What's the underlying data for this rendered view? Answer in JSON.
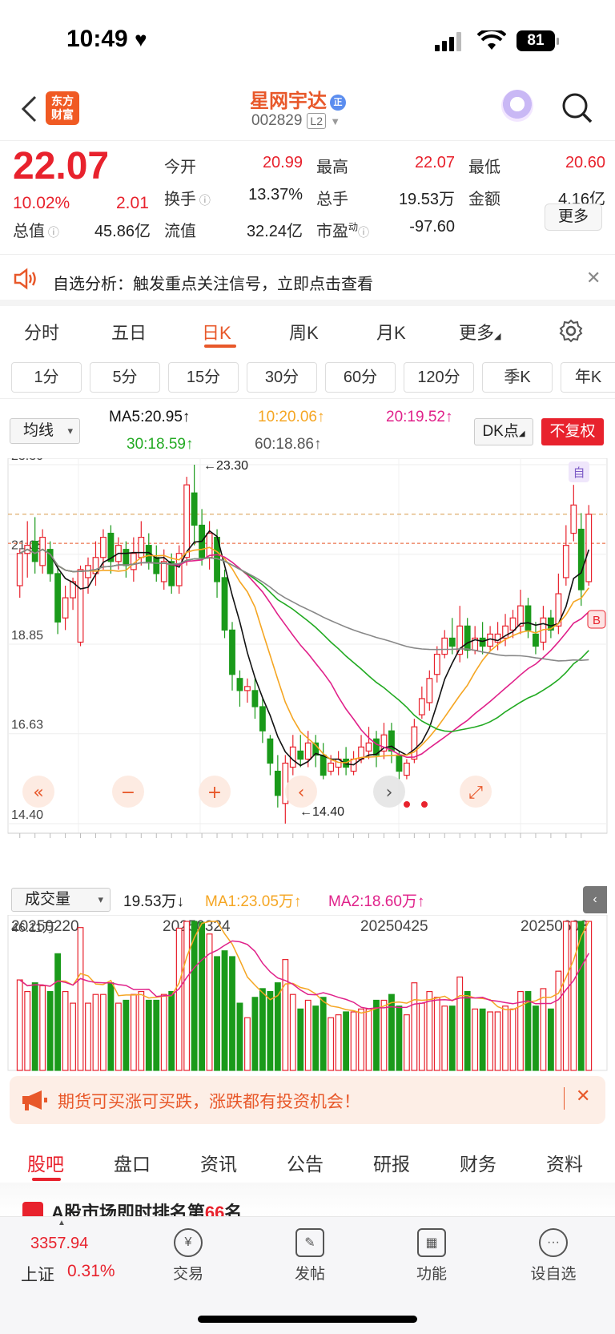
{
  "status": {
    "time": "10:49",
    "heart": "♥",
    "battery": "81"
  },
  "header": {
    "logo_line1": "东方",
    "logo_line2": "财富",
    "name": "星网宇达",
    "badge": "正",
    "code": "002829",
    "level": "L2"
  },
  "quote": {
    "price": "22.07",
    "change_pct": "10.02%",
    "change": "2.01",
    "fields": [
      {
        "k": "今开",
        "v": "20.99",
        "color": "red"
      },
      {
        "k": "最高",
        "v": "22.07",
        "color": "red"
      },
      {
        "k": "最低",
        "v": "20.60",
        "color": "red"
      },
      {
        "k": "换手",
        "v": "13.37%",
        "color": "black"
      },
      {
        "k": "总手",
        "v": "19.53万",
        "color": "black"
      },
      {
        "k": "金额",
        "v": "4.16亿",
        "color": "black"
      },
      {
        "k": "总值",
        "v": "45.86亿",
        "color": "black"
      },
      {
        "k": "流值",
        "v": "32.24亿",
        "color": "black"
      },
      {
        "k": "市盈",
        "v": "-97.60",
        "color": "black"
      }
    ],
    "pe_sup": "动",
    "more": "更多"
  },
  "notice": {
    "text": "自选分析：触发重点关注信号，立即点击查看"
  },
  "tabs": [
    {
      "label": "分时"
    },
    {
      "label": "五日"
    },
    {
      "label": "日K"
    },
    {
      "label": "周K"
    },
    {
      "label": "月K"
    },
    {
      "label": "更多"
    }
  ],
  "periods": [
    "1分",
    "5分",
    "15分",
    "30分",
    "60分",
    "120分",
    "季K",
    "年K"
  ],
  "indicators": {
    "selector": "均线",
    "ma5": "MA5:20.95↑",
    "ma10": "10:20.06↑",
    "ma20": "20:19.52↑",
    "ma30": "30:18.59↑",
    "ma60": "60:18.86↑",
    "dk": "DK点",
    "adjust": "不复权"
  },
  "chart_data": {
    "type": "candlestick",
    "y_ticks": [
      "23.30",
      "21.08",
      "18.85",
      "16.63",
      "14.40"
    ],
    "x_ticks": [
      "20250220",
      "20250324",
      "20250425",
      "20250603"
    ],
    "high_label": "←23.30",
    "low_label": "←14.40",
    "marker_top": "自",
    "marker_buy": "B",
    "candles": [
      [
        20.3,
        21.1,
        20.0,
        21.2
      ],
      [
        21.1,
        21.3,
        20.5,
        21.9
      ],
      [
        21.4,
        20.9,
        20.6,
        22.0
      ],
      [
        20.8,
        21.5,
        20.6,
        21.7
      ],
      [
        21.2,
        20.6,
        20.4,
        21.4
      ],
      [
        20.6,
        19.4,
        19.1,
        20.8
      ],
      [
        19.5,
        20.0,
        19.2,
        20.3
      ],
      [
        20.0,
        20.4,
        19.7,
        20.5
      ],
      [
        18.9,
        20.7,
        18.8,
        20.8
      ],
      [
        20.5,
        20.8,
        20.1,
        21.0
      ],
      [
        20.6,
        21.0,
        20.3,
        21.4
      ],
      [
        21.0,
        21.5,
        20.7,
        21.7
      ],
      [
        21.6,
        20.9,
        20.6,
        21.8
      ],
      [
        20.9,
        21.3,
        20.7,
        21.5
      ],
      [
        21.2,
        20.8,
        20.5,
        21.4
      ],
      [
        20.7,
        21.1,
        20.4,
        21.5
      ],
      [
        21.0,
        21.5,
        20.8,
        21.9
      ],
      [
        21.3,
        20.9,
        20.7,
        21.6
      ],
      [
        21.0,
        20.6,
        20.4,
        21.3
      ],
      [
        20.4,
        20.9,
        20.2,
        21.2
      ],
      [
        20.9,
        20.3,
        20.1,
        21.1
      ],
      [
        20.3,
        21.1,
        20.1,
        21.3
      ],
      [
        21.0,
        22.8,
        20.8,
        23.0
      ],
      [
        22.6,
        21.8,
        21.3,
        23.3
      ],
      [
        21.8,
        21.0,
        20.8,
        22.2
      ],
      [
        21.0,
        21.6,
        20.7,
        21.9
      ],
      [
        21.5,
        20.4,
        20.0,
        21.7
      ],
      [
        20.5,
        19.2,
        19.0,
        20.7
      ],
      [
        19.2,
        18.1,
        17.7,
        19.4
      ],
      [
        18.0,
        17.7,
        17.3,
        18.2
      ],
      [
        17.7,
        17.8,
        17.4,
        18.0
      ],
      [
        17.7,
        17.3,
        17.0,
        18.0
      ],
      [
        17.3,
        16.7,
        16.4,
        17.5
      ],
      [
        16.5,
        15.9,
        15.6,
        16.6
      ],
      [
        15.7,
        15.1,
        14.8,
        16.1
      ],
      [
        14.9,
        15.9,
        14.4,
        16.1
      ],
      [
        15.8,
        16.3,
        15.6,
        16.6
      ],
      [
        16.2,
        16.0,
        15.8,
        16.6
      ],
      [
        16.0,
        16.4,
        15.8,
        16.7
      ],
      [
        16.4,
        16.1,
        15.8,
        16.6
      ],
      [
        16.1,
        15.6,
        15.5,
        16.4
      ],
      [
        15.7,
        15.9,
        15.6,
        16.1
      ],
      [
        15.8,
        16.0,
        15.6,
        16.2
      ],
      [
        16.0,
        15.8,
        15.6,
        16.3
      ],
      [
        15.7,
        16.0,
        15.6,
        16.2
      ],
      [
        16.0,
        16.3,
        15.9,
        16.6
      ],
      [
        16.2,
        16.4,
        16.0,
        16.8
      ],
      [
        16.5,
        16.1,
        15.8,
        16.7
      ],
      [
        16.2,
        16.6,
        16.0,
        16.9
      ],
      [
        16.7,
        16.2,
        15.9,
        16.9
      ],
      [
        16.1,
        15.7,
        15.5,
        16.2
      ],
      [
        15.6,
        15.9,
        15.5,
        16.0
      ],
      [
        16.0,
        16.8,
        15.9,
        17.0
      ],
      [
        17.1,
        17.5,
        17.0,
        17.8
      ],
      [
        17.4,
        18.0,
        17.2,
        18.2
      ],
      [
        18.1,
        18.6,
        17.9,
        18.8
      ],
      [
        18.6,
        19.0,
        18.5,
        19.2
      ],
      [
        19.0,
        18.8,
        18.6,
        19.5
      ],
      [
        18.6,
        19.3,
        18.4,
        19.8
      ],
      [
        19.3,
        18.7,
        18.5,
        19.5
      ],
      [
        18.7,
        19.0,
        18.6,
        19.3
      ],
      [
        19.0,
        18.8,
        18.6,
        19.4
      ],
      [
        18.8,
        19.1,
        18.7,
        19.3
      ],
      [
        18.9,
        19.1,
        18.7,
        19.4
      ],
      [
        19.0,
        19.3,
        18.8,
        19.6
      ],
      [
        19.2,
        19.5,
        19.0,
        19.7
      ],
      [
        19.3,
        19.8,
        19.1,
        20.2
      ],
      [
        19.8,
        19.2,
        19.0,
        20.0
      ],
      [
        19.1,
        18.8,
        18.6,
        19.4
      ],
      [
        18.9,
        19.5,
        18.7,
        19.8
      ],
      [
        19.5,
        19.2,
        19.0,
        19.7
      ],
      [
        19.3,
        20.1,
        19.1,
        20.6
      ],
      [
        20.5,
        21.3,
        20.3,
        21.8
      ],
      [
        21.6,
        22.3,
        21.4,
        22.8
      ],
      [
        21.7,
        20.2,
        19.8,
        22.1
      ],
      [
        20.4,
        22.07,
        20.3,
        22.3
      ]
    ],
    "volume_label": "成交量",
    "volume": "19.53万↓",
    "vol_ma1": "MA1:23.05万↑",
    "vol_ma2": "MA2:18.60万↑",
    "vol_max": "46.11万"
  },
  "banner": {
    "text": "期货可买涨可买跌，涨跌都有投资机会！"
  },
  "bottom_tabs": [
    "股吧",
    "盘口",
    "资讯",
    "公告",
    "研报",
    "财务",
    "资料"
  ],
  "ticker": {
    "text": "A股市场即时排名第",
    "rank": "66",
    "suffix": "名"
  },
  "nav": {
    "index": "3357.94",
    "index_name": "上证",
    "index_pct": "0.31%",
    "items": [
      "交易",
      "发帖",
      "功能",
      "设自选"
    ]
  },
  "colors": {
    "up": "#e8222d",
    "down": "#1a9a1a",
    "ma5": "#111111",
    "ma10": "#f5a623",
    "ma20": "#e0218a",
    "ma30": "#22aa22",
    "ma60": "#888888"
  }
}
